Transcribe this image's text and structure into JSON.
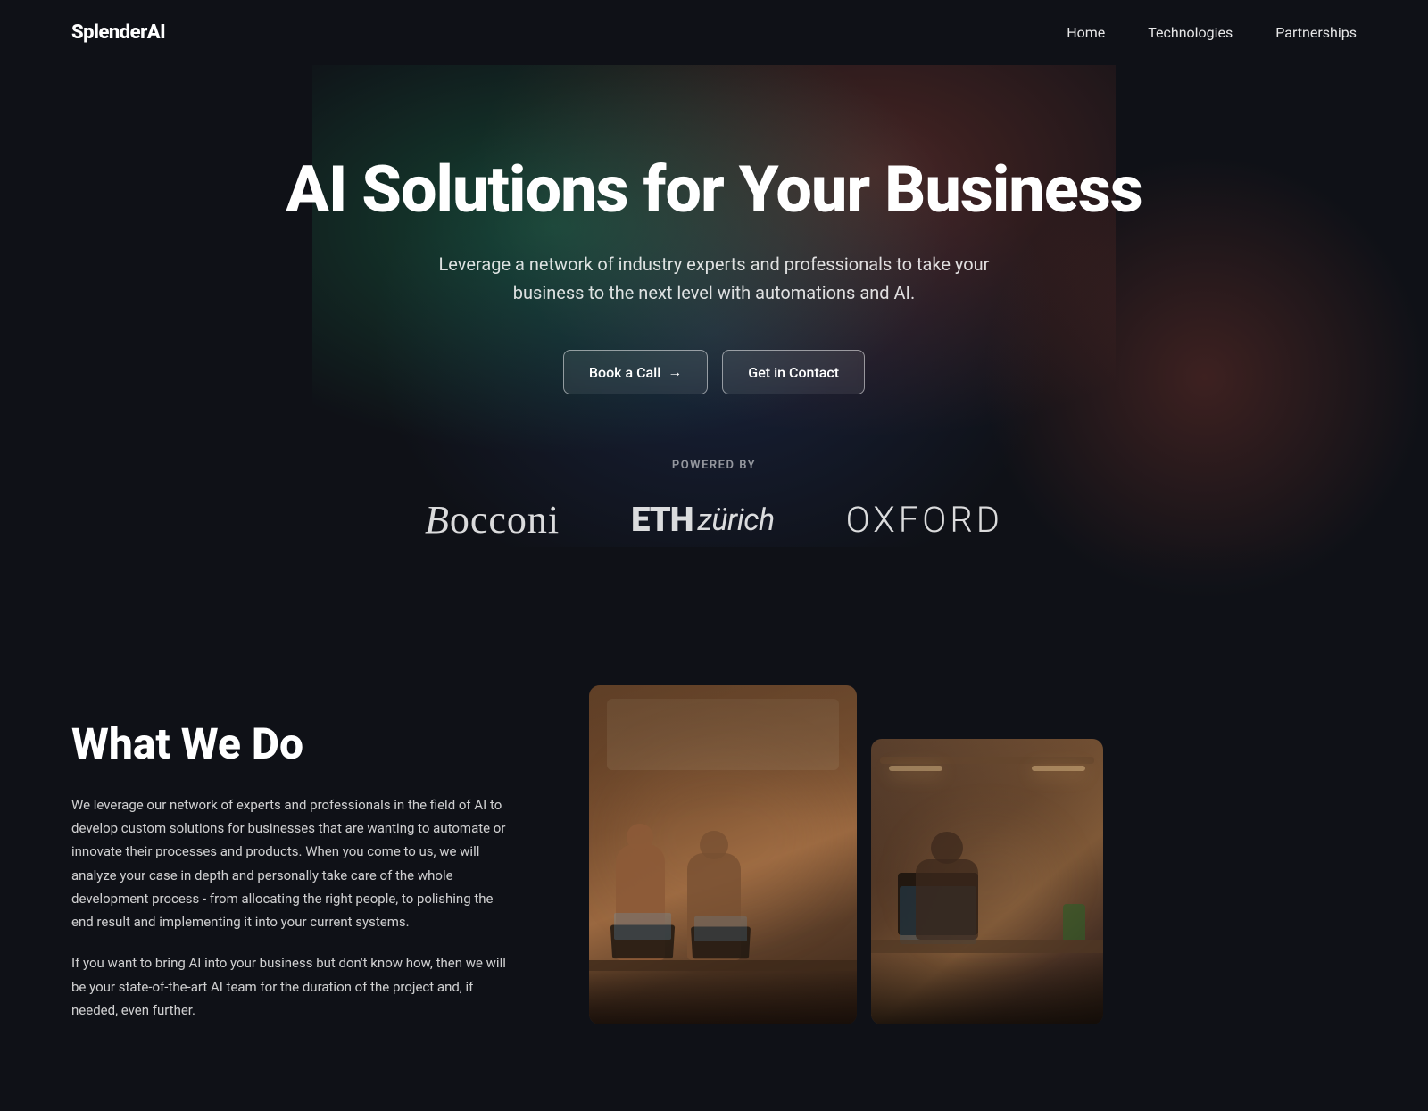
{
  "site": {
    "logo": "SplenderAI",
    "nav": {
      "links": [
        {
          "label": "Home",
          "href": "#"
        },
        {
          "label": "Technologies",
          "href": "#"
        },
        {
          "label": "Partnerships",
          "href": "#"
        }
      ]
    }
  },
  "hero": {
    "title": "AI Solutions for Your Business",
    "subtitle": "Leverage a network of industry experts and professionals to take your business to the next level with automations and AI.",
    "cta_primary": "Book a Call",
    "cta_primary_arrow": "→",
    "cta_secondary": "Get in Contact",
    "powered_by_label": "POWERED BY",
    "partners": [
      {
        "name": "Bocconi",
        "style": "serif"
      },
      {
        "name": "ETHzürich",
        "style": "bold"
      },
      {
        "name": "OXFORD",
        "style": "light"
      }
    ]
  },
  "what_we_do": {
    "title": "What We Do",
    "paragraphs": [
      "We leverage our network of experts and professionals in the field of AI to develop custom solutions for businesses that are wanting to automate or innovate their processes and products. When you come to us, we will analyze your case in depth and personally take care of the whole development process - from allocating the right people, to polishing the end result and implementing it into your current systems.",
      "If you want to bring AI into your business but don't know how, then we will be your state-of-the-art AI team for the duration of the project and, if needed, even further."
    ]
  }
}
